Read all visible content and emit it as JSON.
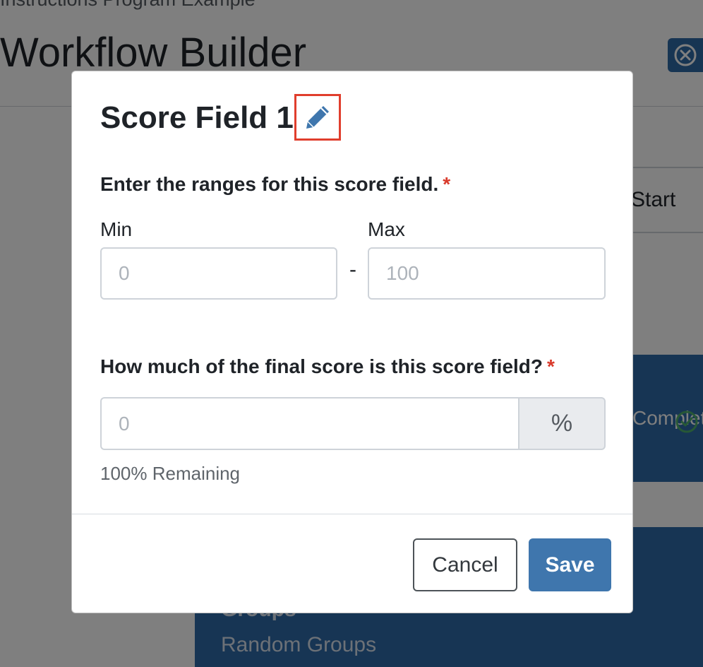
{
  "background": {
    "subtitle": "Instructions Program Example",
    "title": "Workflow Builder",
    "start_label": "Start",
    "panel_label": "Completion",
    "groups_label": "Groups",
    "random_groups_label": "Random Groups"
  },
  "modal": {
    "title": "Score Field 1",
    "range_label": "Enter the ranges for this score field.",
    "required_marker": "*",
    "min_label": "Min",
    "min_placeholder": "0",
    "range_separator": "-",
    "max_label": "Max",
    "max_placeholder": "100",
    "weight_label": "How much of the final score is this score field?",
    "weight_placeholder": "0",
    "weight_addon": "%",
    "remaining_text": "100% Remaining",
    "cancel_label": "Cancel",
    "save_label": "Save"
  },
  "colors": {
    "primary": "#3f76ad",
    "required": "#d93a2b",
    "highlight": "#e03e2d",
    "overlay": "rgba(0,0,0,0.5)"
  },
  "icons": {
    "edit": "pencil-icon",
    "close": "close-circle-icon",
    "check": "check-circle-icon"
  }
}
